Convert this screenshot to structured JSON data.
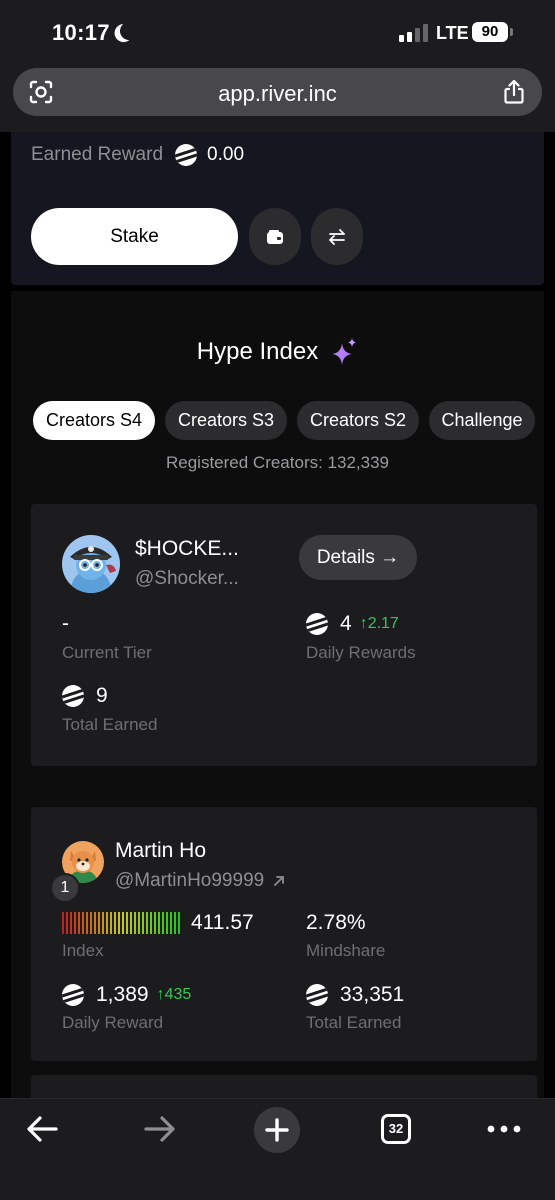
{
  "status": {
    "time": "10:17",
    "network": "LTE",
    "battery": "90"
  },
  "browser": {
    "url": "app.river.inc",
    "tabs_count": "32"
  },
  "stake": {
    "earned_label": "Earned Reward",
    "earned_value": "0.00",
    "stake_label": "Stake"
  },
  "hype": {
    "title": "Hype Index",
    "tabs": [
      {
        "label": "Creators S4",
        "active": true
      },
      {
        "label": "Creators S3",
        "active": false
      },
      {
        "label": "Creators S2",
        "active": false
      },
      {
        "label": "Challenge",
        "active": false
      }
    ],
    "registered": "Registered Creators: 132,339",
    "my_card": {
      "name": "$HOCKE...",
      "handle": "@Shocker...",
      "details_label": "Details →",
      "tier_value": "-",
      "tier_label": "Current Tier",
      "daily_value": "4",
      "daily_delta": "↑2.17",
      "daily_label": "Daily Rewards",
      "total_value": "9",
      "total_label": "Total Earned"
    },
    "leader_card": {
      "rank": "1",
      "name": "Martin Ho",
      "handle": "@MartinHo99999",
      "index_value": "411.57",
      "index_label": "Index",
      "mindshare_value": "2.78%",
      "mindshare_label": "Mindshare",
      "daily_value": "1,389",
      "daily_delta": "↑435",
      "daily_label": "Daily Reward",
      "total_value": "33,351",
      "total_label": "Total Earned"
    }
  },
  "colors": {
    "accent_green": "#34c759",
    "sparkle": "#b57cff"
  }
}
